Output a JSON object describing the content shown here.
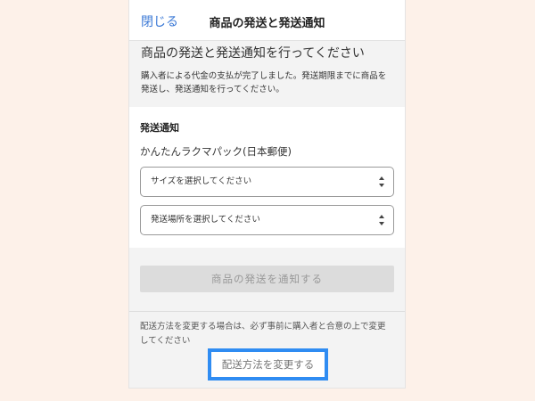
{
  "header": {
    "close_label": "閉じる",
    "title": "商品の発送と発送通知"
  },
  "notice": {
    "heading": "商品の発送と発送通知を行ってください",
    "body": "購入者による代金の支払が完了しました。発送期限までに商品を発送し、発送通知を行ってください。"
  },
  "shipping": {
    "section_label": "発送通知",
    "method": "かんたんラクマパック(日本郵便)",
    "size_select": {
      "value": "サイズを選択してください"
    },
    "location_select": {
      "value": "発送場所を選択してください"
    }
  },
  "actions": {
    "notify_label": "商品の発送を通知する",
    "change_note": "配送方法を変更する場合は、必ず事前に購入者と合意の上で変更してください",
    "change_link": "配送方法を変更する"
  },
  "colors": {
    "link": "#3b79d6",
    "highlight": "#2f8cf2",
    "disabled_button": "#dcdcdc",
    "page_background": "#fdf1e9"
  }
}
